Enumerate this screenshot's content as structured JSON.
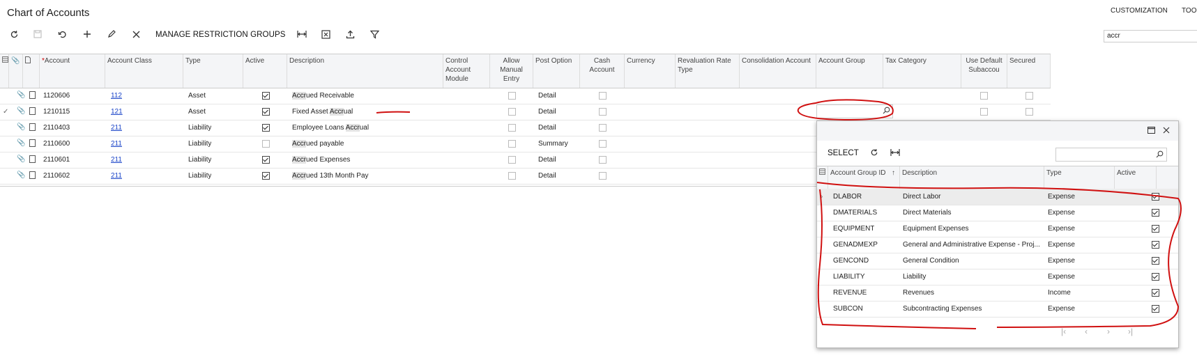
{
  "page": {
    "title": "Chart of Accounts",
    "customization": "CUSTOMIZATION",
    "tools": "TOO"
  },
  "toolbar": {
    "manage_label": "MANAGE RESTRICTION GROUPS",
    "search_value": "accr"
  },
  "columns": {
    "account_required": "*",
    "account": "Account",
    "account_class": "Account Class",
    "type": "Type",
    "active": "Active",
    "description": "Description",
    "control_account_module": "Control Account Module",
    "allow_manual_entry": "Allow Manual Entry",
    "post_option": "Post Option",
    "cash_account": "Cash Account",
    "currency": "Currency",
    "revaluation_rate_type": "Revaluation Rate Type",
    "consolidation_account": "Consolidation Account",
    "account_group": "Account Group",
    "tax_category": "Tax Category",
    "use_default_subaccount": "Use Default Subaccou",
    "secured": "Secured"
  },
  "rows": [
    {
      "account": "1120606",
      "class": "112",
      "type": "Asset",
      "active": true,
      "desc_hl": "Accr",
      "desc_pre": "",
      "desc_post": "ued Receivable",
      "post": "Detail"
    },
    {
      "account": "1210115",
      "class": "121",
      "type": "Asset",
      "active": true,
      "desc_pre": "Fixed Asset ",
      "desc_hl": "Accr",
      "desc_post": "ual",
      "post": "Detail"
    },
    {
      "account": "2110403",
      "class": "211",
      "type": "Liability",
      "active": true,
      "desc_pre": "Employee Loans ",
      "desc_hl": "Accr",
      "desc_post": "ual",
      "post": "Detail"
    },
    {
      "account": "2110600",
      "class": "211",
      "type": "Liability",
      "active": false,
      "desc_pre": "",
      "desc_hl": "Accr",
      "desc_post": "ued payable",
      "post": "Summary"
    },
    {
      "account": "2110601",
      "class": "211",
      "type": "Liability",
      "active": true,
      "desc_pre": "",
      "desc_hl": "Accr",
      "desc_post": "ued Expenses",
      "post": "Detail"
    },
    {
      "account": "2110602",
      "class": "211",
      "type": "Liability",
      "active": true,
      "desc_pre": "",
      "desc_hl": "Accr",
      "desc_post": "ued 13th Month Pay",
      "post": "Detail"
    }
  ],
  "popup": {
    "select_label": "SELECT",
    "col_group_id": "Account Group ID",
    "col_description": "Description",
    "col_type": "Type",
    "col_active": "Active",
    "sort_indicator": "↑",
    "rows": [
      {
        "id": "DLABOR",
        "description": "Direct Labor",
        "type": "Expense",
        "active": true
      },
      {
        "id": "DMATERIALS",
        "description": "Direct Materials",
        "type": "Expense",
        "active": true
      },
      {
        "id": "EQUIPMENT",
        "description": "Equipment Expenses",
        "type": "Expense",
        "active": true
      },
      {
        "id": "GENADMEXP",
        "description": "General and Administrative Expense - Proj...",
        "type": "Expense",
        "active": true
      },
      {
        "id": "GENCOND",
        "description": "General Condition",
        "type": "Expense",
        "active": true
      },
      {
        "id": "LIABILITY",
        "description": "Liability",
        "type": "Expense",
        "active": true
      },
      {
        "id": "REVENUE",
        "description": "Revenues",
        "type": "Income",
        "active": true
      },
      {
        "id": "SUBCON",
        "description": "Subcontracting Expenses",
        "type": "Expense",
        "active": true
      }
    ]
  },
  "icons": [
    "refresh-icon",
    "save-icon",
    "undo-icon",
    "add-icon",
    "edit-icon",
    "delete-icon",
    "fit-columns-icon",
    "export-excel-icon",
    "upload-icon",
    "filter-icon",
    "search-icon",
    "maximize-icon",
    "close-icon"
  ],
  "annotation_color": "#d01010"
}
